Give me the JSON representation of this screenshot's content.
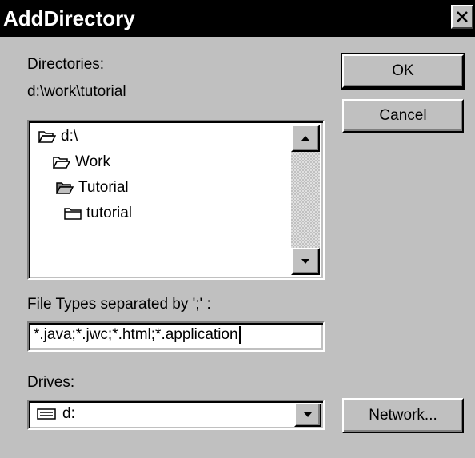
{
  "window": {
    "title": "AddDirectory",
    "close_glyph": "✕"
  },
  "directories": {
    "label_first": "D",
    "label_rest": "irectories:",
    "current_path": "d:\\work\\tutorial",
    "items": [
      {
        "name": "d:\\",
        "icon": "open-folder-icon"
      },
      {
        "name": "Work",
        "icon": "open-folder-icon"
      },
      {
        "name": "Tutorial",
        "icon": "open-folder-filled-icon"
      },
      {
        "name": "tutorial",
        "icon": "closed-folder-icon"
      }
    ]
  },
  "file_types": {
    "label": "File Types separated by ';' :",
    "value": "*.java;*.jwc;*.html;*.application"
  },
  "drives": {
    "label_before": "Dri",
    "label_underlined": "v",
    "label_after": "es:",
    "selected": "d:",
    "icon": "drive-icon"
  },
  "buttons": {
    "ok": "OK",
    "cancel": "Cancel",
    "network": "Network..."
  }
}
